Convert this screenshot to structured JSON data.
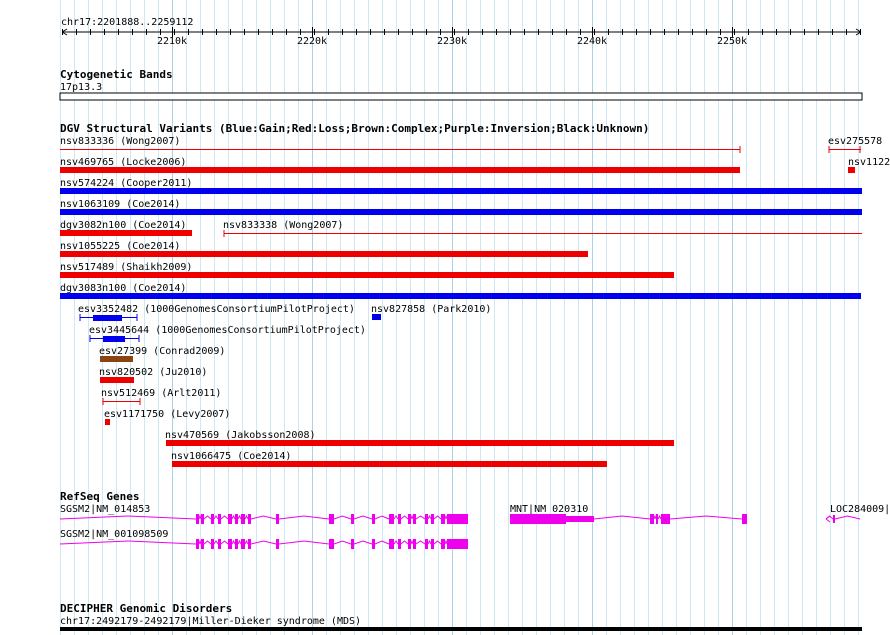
{
  "browser": {
    "region": "chr17:2201888..2259112",
    "ruler_ticks": [
      "2210k",
      "2220k",
      "2230k",
      "2240k",
      "2250k"
    ]
  },
  "tracks": {
    "cytoband": {
      "title": "Cytogenetic Bands",
      "band_label": "17p13.3"
    },
    "dgv": {
      "title": "DGV Structural Variants (Blue:Gain;Red:Loss;Brown:Complex;Purple:Inversion;Black:Unknown)",
      "color_legend": {
        "gain": "#0000EE",
        "loss": "#EE0000",
        "complex": "#8B4513",
        "inversion": "#800080",
        "unknown": "#000000"
      },
      "features": [
        {
          "label": "nsv833336 (Wong2007)",
          "type": "loss",
          "style": "line"
        },
        {
          "label": "esv275578",
          "type": "loss",
          "style": "line"
        },
        {
          "label": "nsv469765 (Locke2006)",
          "type": "loss",
          "style": "bar"
        },
        {
          "label": "nsv1122",
          "type": "loss",
          "style": "bar"
        },
        {
          "label": "nsv574224 (Cooper2011)",
          "type": "gain",
          "style": "bar"
        },
        {
          "label": "nsv1063109 (Coe2014)",
          "type": "gain",
          "style": "bar"
        },
        {
          "label": "dgv3082n100 (Coe2014)",
          "type": "loss",
          "style": "bar"
        },
        {
          "label": "nsv833338 (Wong2007)",
          "type": "loss",
          "style": "line"
        },
        {
          "label": "nsv1055225 (Coe2014)",
          "type": "loss",
          "style": "bar"
        },
        {
          "label": "nsv517489 (Shaikh2009)",
          "type": "loss",
          "style": "bar"
        },
        {
          "label": "dgv3083n100 (Coe2014)",
          "type": "gain",
          "style": "bar"
        },
        {
          "label": "esv3352482 (1000GenomesConsortiumPilotProject)",
          "type": "gain",
          "style": "gapped"
        },
        {
          "label": "nsv827858 (Park2010)",
          "type": "gain",
          "style": "bar"
        },
        {
          "label": "esv3445644 (1000GenomesConsortiumPilotProject)",
          "type": "gain",
          "style": "gapped"
        },
        {
          "label": "esv27399 (Conrad2009)",
          "type": "complex",
          "style": "bar"
        },
        {
          "label": "nsv820502 (Ju2010)",
          "type": "loss",
          "style": "bar"
        },
        {
          "label": "nsv512469 (Arlt2011)",
          "type": "loss",
          "style": "line"
        },
        {
          "label": "esv1171750 (Levy2007)",
          "type": "loss",
          "style": "bar"
        },
        {
          "label": "nsv470569 (Jakobsson2008)",
          "type": "loss",
          "style": "bar"
        },
        {
          "label": "nsv1066475 (Coe2014)",
          "type": "loss",
          "style": "bar"
        }
      ]
    },
    "refseq": {
      "title": "RefSeq Genes",
      "gene_color": "#EE00EE",
      "genes": [
        {
          "label": "SGSM2|NM_014853"
        },
        {
          "label": "MNT|NM_020310"
        },
        {
          "label": "LOC284009|"
        },
        {
          "label": "SGSM2|NM_001098509"
        }
      ]
    },
    "decipher": {
      "title": "DECIPHER Genomic Disorders",
      "label": "chr17:2492179-2492179|Miller-Dieker syndrome (MDS)"
    }
  }
}
